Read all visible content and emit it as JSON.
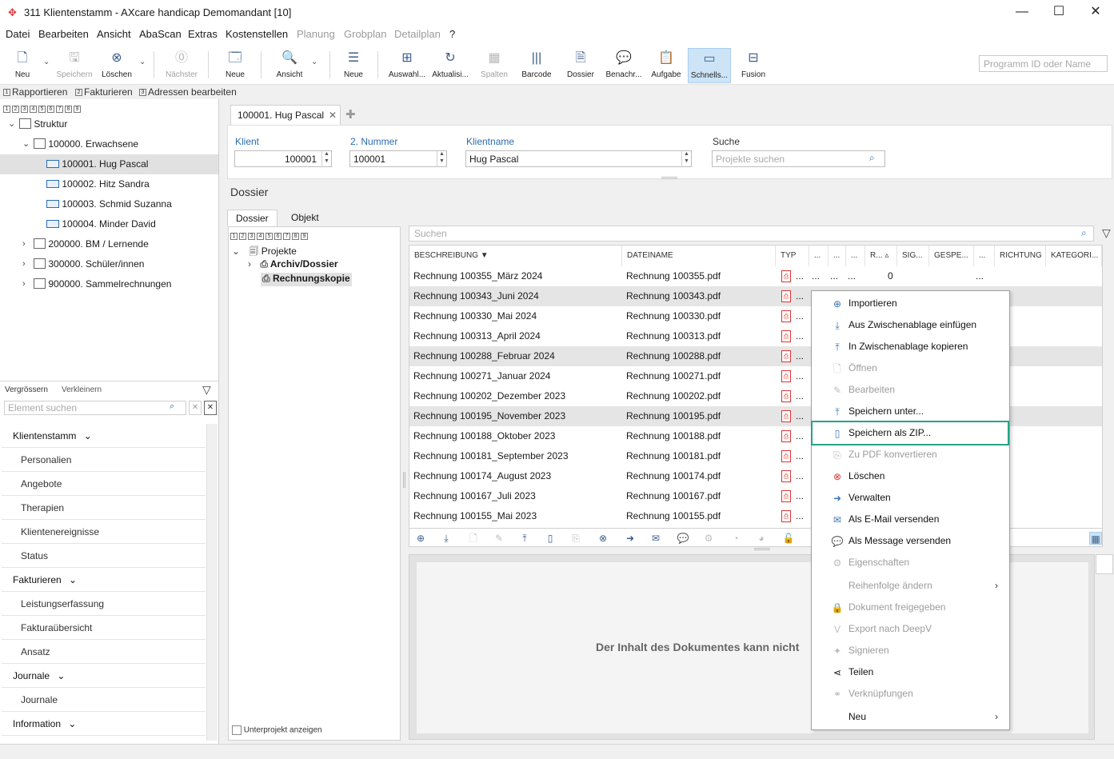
{
  "window": {
    "title": "311 Klientenstamm - AXcare handicap Demomandant [10]",
    "minimize": "—",
    "maximize": "☐",
    "close": "✕"
  },
  "menu": [
    "Datei",
    "Bearbeiten",
    "Ansicht",
    "AbaScan",
    "Extras",
    "Kostenstellen",
    "Planung",
    "Grobplan",
    "Detailplan",
    "?"
  ],
  "toolbar": {
    "neu": "Neu",
    "speichern": "Speichern",
    "loeschen": "Löschen",
    "naechster": "Nächster",
    "neue1": "Neue",
    "ansicht": "Ansicht",
    "neue2": "Neue",
    "auswahl": "Auswahl...",
    "aktualisieren": "Aktualisi...",
    "spalten": "Spalten",
    "barcode": "Barcode",
    "dossier": "Dossier",
    "benachr": "Benachr...",
    "aufgabe": "Aufgabe",
    "schnells": "Schnells...",
    "fusion": "Fusion",
    "program_id_placeholder": "Programm ID oder Name"
  },
  "quickbar": {
    "items": [
      "Rapportieren",
      "Fakturieren",
      "Adressen bearbeiten"
    ],
    "numbers": [
      "1",
      "2",
      "3"
    ]
  },
  "level_numbers": [
    "1",
    "2",
    "3",
    "4",
    "5",
    "6",
    "7",
    "8",
    "9"
  ],
  "tree": {
    "root": "Struktur",
    "groups": [
      {
        "label": "100000. Erwachsene"
      },
      {
        "label": "200000. BM / Lernende"
      },
      {
        "label": "300000. Schüler/innen"
      },
      {
        "label": "900000. Sammelrechnungen"
      }
    ],
    "clients": [
      {
        "label": "100001. Hug Pascal"
      },
      {
        "label": "100002. Hitz Sandra"
      },
      {
        "label": "100003. Schmid Suzanna"
      },
      {
        "label": "100004. Minder David"
      }
    ]
  },
  "leftpanel": {
    "zoom_in": "Vergrössern",
    "zoom_out": "Verkleinern",
    "search_placeholder": "Element suchen"
  },
  "nav": [
    {
      "label": "Klientenstamm",
      "type": "head"
    },
    {
      "label": "Personalien",
      "type": "sub"
    },
    {
      "label": "Angebote",
      "type": "sub"
    },
    {
      "label": "Therapien",
      "type": "sub"
    },
    {
      "label": "Klientenereignisse",
      "type": "sub"
    },
    {
      "label": "Status",
      "type": "sub"
    },
    {
      "label": "Fakturieren",
      "type": "head"
    },
    {
      "label": "Leistungserfassung",
      "type": "sub"
    },
    {
      "label": "Fakturaübersicht",
      "type": "sub"
    },
    {
      "label": "Ansatz",
      "type": "sub"
    },
    {
      "label": "Journale",
      "type": "head"
    },
    {
      "label": "Journale",
      "type": "sub"
    },
    {
      "label": "Information",
      "type": "head"
    }
  ],
  "doctab": {
    "label": "100001. Hug Pascal"
  },
  "form": {
    "klient_label": "Klient",
    "klient_value": "100001",
    "nummer_label": "2. Nummer",
    "nummer_value": "100001",
    "name_label": "Klientname",
    "name_value": "Hug Pascal",
    "suche_label": "Suche",
    "suche_placeholder": "Projekte suchen"
  },
  "dossier": {
    "title": "Dossier",
    "tab_dossier": "Dossier",
    "tab_objekt": "Objekt",
    "projekte": "Projekte",
    "archiv": "Archiv/Dossier",
    "rechnungskopie": "Rechnungskopie",
    "unterprojekt": "Unterprojekt anzeigen",
    "list_search_placeholder": "Suchen",
    "preview_text": "Der Inhalt des Dokumentes kann nicht"
  },
  "columns": [
    "BESCHREIBUNG",
    "DATEINAME",
    "TYP",
    "...",
    "...",
    "...",
    "R...",
    "SIG...",
    "GESPE...",
    "...",
    "RICHTUNG",
    "KATEGORI..."
  ],
  "rows": [
    {
      "beschreibung": "Rechnung 100355_März 2024",
      "dateiname": "Rechnung 100355.pdf",
      "r": "0"
    },
    {
      "beschreibung": "Rechnung 100343_Juni 2024",
      "dateiname": "Rechnung 100343.pdf",
      "r": ""
    },
    {
      "beschreibung": "Rechnung 100330_Mai 2024",
      "dateiname": "Rechnung 100330.pdf",
      "r": ""
    },
    {
      "beschreibung": "Rechnung 100313_April 2024",
      "dateiname": "Rechnung 100313.pdf",
      "r": ""
    },
    {
      "beschreibung": "Rechnung 100288_Februar 2024",
      "dateiname": "Rechnung 100288.pdf",
      "r": ""
    },
    {
      "beschreibung": "Rechnung 100271_Januar 2024",
      "dateiname": "Rechnung 100271.pdf",
      "r": ""
    },
    {
      "beschreibung": "Rechnung 100202_Dezember 2023",
      "dateiname": "Rechnung 100202.pdf",
      "r": ""
    },
    {
      "beschreibung": "Rechnung 100195_November 2023",
      "dateiname": "Rechnung 100195.pdf",
      "r": ""
    },
    {
      "beschreibung": "Rechnung 100188_Oktober 2023",
      "dateiname": "Rechnung 100188.pdf",
      "r": ""
    },
    {
      "beschreibung": "Rechnung 100181_September 2023",
      "dateiname": "Rechnung 100181.pdf",
      "r": ""
    },
    {
      "beschreibung": "Rechnung 100174_August 2023",
      "dateiname": "Rechnung 100174.pdf",
      "r": ""
    },
    {
      "beschreibung": "Rechnung 100167_Juli 2023",
      "dateiname": "Rechnung 100167.pdf",
      "r": ""
    },
    {
      "beschreibung": "Rechnung 100155_Mai 2023",
      "dateiname": "Rechnung 100155.pdf",
      "r": ""
    }
  ],
  "row_more": "...",
  "context_menu": [
    {
      "label": "Importieren",
      "disabled": false,
      "icon": "import-icon"
    },
    {
      "label": "Aus Zwischenablage einfügen",
      "disabled": false,
      "icon": "download-icon"
    },
    {
      "label": "In Zwischenablage kopieren",
      "disabled": false,
      "icon": "upload-icon"
    },
    {
      "label": "Öffnen",
      "disabled": true,
      "icon": "open-icon"
    },
    {
      "label": "Bearbeiten",
      "disabled": true,
      "icon": "edit-icon"
    },
    {
      "label": "Speichern unter...",
      "disabled": false,
      "icon": "save-as-icon"
    },
    {
      "label": "Speichern als ZIP...",
      "disabled": false,
      "icon": "zip-icon"
    },
    {
      "label": "Zu PDF konvertieren",
      "disabled": true,
      "icon": "pdf-icon"
    },
    {
      "label": "Löschen",
      "disabled": false,
      "icon": "delete-icon"
    },
    {
      "label": "Verwalten",
      "disabled": false,
      "icon": "manage-icon"
    },
    {
      "label": "Als E-Mail versenden",
      "disabled": false,
      "icon": "email-icon"
    },
    {
      "label": "Als Message versenden",
      "disabled": false,
      "icon": "message-icon"
    },
    {
      "label": "Eigenschaften",
      "disabled": true,
      "icon": "gear-icon"
    },
    {
      "label": "Reihenfolge ändern",
      "disabled": true,
      "icon": "order-icon",
      "submenu": true
    },
    {
      "label": "Dokument freigegeben",
      "disabled": true,
      "icon": "lock-icon"
    },
    {
      "label": "Export nach DeepV",
      "disabled": true,
      "icon": "deepv-icon"
    },
    {
      "label": "Signieren",
      "disabled": true,
      "icon": "sign-icon"
    },
    {
      "label": "Teilen",
      "disabled": false,
      "icon": "share-icon"
    },
    {
      "label": "Verknüpfungen",
      "disabled": true,
      "icon": "link-icon"
    },
    {
      "label": "Neu",
      "disabled": false,
      "icon": "new-icon",
      "submenu": true
    }
  ],
  "colors": {
    "accent": "#2b6cb0",
    "highlight": "#26a386",
    "pdf": "#d33333"
  }
}
